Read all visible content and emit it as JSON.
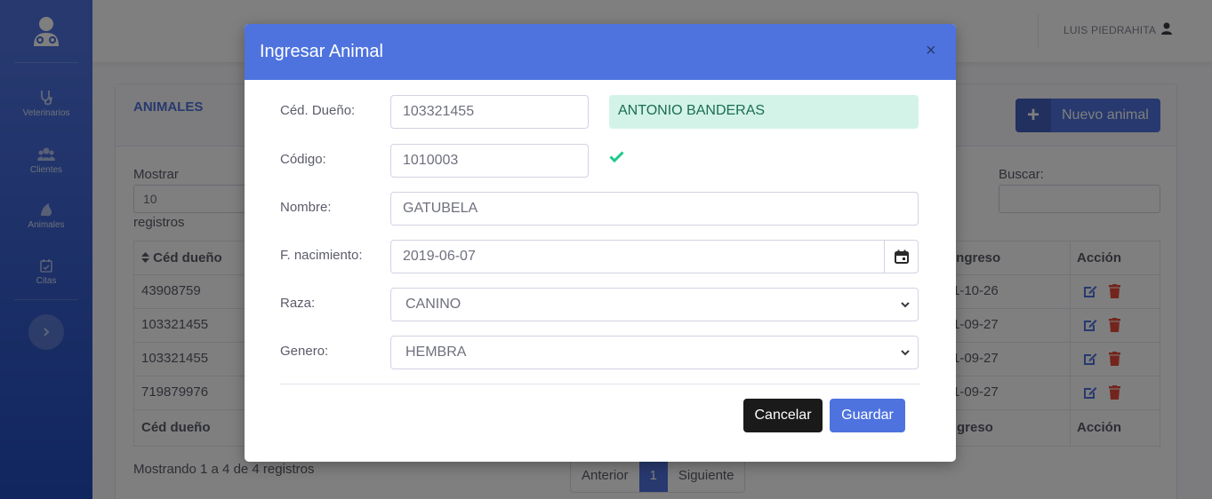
{
  "colors": {
    "primary": "#4e73df",
    "success_bg": "#d4f3e8",
    "danger": "#e74a3b",
    "check": "#1cc88a"
  },
  "sidebar": {
    "brand_icon": "doctor-icon",
    "items": [
      {
        "label": "Veterinarios",
        "icon": "stethoscope-icon"
      },
      {
        "label": "Clientes",
        "icon": "users-icon"
      },
      {
        "label": "Animales",
        "icon": "paw-icon"
      },
      {
        "label": "Citas",
        "icon": "calendar-check-icon"
      }
    ],
    "toggle_icon": "chevron-right-icon"
  },
  "topbar": {
    "user_name": "LUIS PIEDRAHITA",
    "user_icon": "user-icon"
  },
  "card": {
    "title": "ANIMALES",
    "new_button": "Nuevo animal",
    "show_label": "Mostrar",
    "show_value": "10",
    "records_label": "registros",
    "search_label": "Buscar:",
    "table": {
      "headers": [
        "Céd dueño",
        "ingreso",
        "Acción"
      ],
      "rows": [
        {
          "ced": "43908759",
          "ingreso": "1-10-26"
        },
        {
          "ced": "103321455",
          "ingreso": "1-09-27"
        },
        {
          "ced": "103321455",
          "ingreso": "1-09-27"
        },
        {
          "ced": "719879976",
          "ingreso": "1-09-27"
        }
      ],
      "footers": [
        "Céd dueño",
        "greso",
        "Acción"
      ]
    },
    "info": "Mostrando 1 a 4 de 4 registros",
    "pager": {
      "prev": "Anterior",
      "page": "1",
      "next": "Siguiente"
    }
  },
  "modal": {
    "title": "Ingresar Animal",
    "close": "×",
    "fields": {
      "owner_id_label": "Céd. Dueño:",
      "owner_id_value": "103321455",
      "owner_name": "ANTONIO BANDERAS",
      "code_label": "Código:",
      "code_value": "1010003",
      "name_label": "Nombre:",
      "name_value": "GATUBELA",
      "birth_label": "F. nacimiento:",
      "birth_value": "2019-06-07",
      "breed_label": "Raza:",
      "breed_value": "CANINO",
      "gender_label": "Genero:",
      "gender_value": "HEMBRA"
    },
    "cancel": "Cancelar",
    "save": "Guardar"
  }
}
